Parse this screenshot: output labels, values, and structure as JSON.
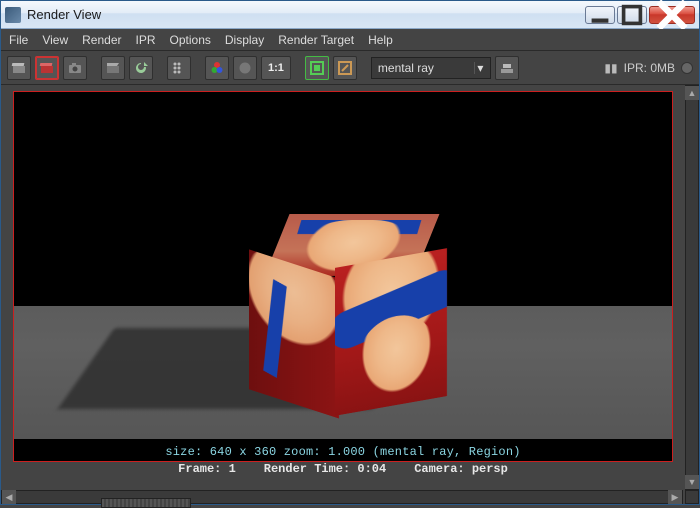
{
  "window": {
    "title": "Render View"
  },
  "menus": {
    "file": "File",
    "view": "View",
    "render": "Render",
    "ipr": "IPR",
    "options": "Options",
    "display": "Display",
    "render_target": "Render Target",
    "help": "Help"
  },
  "toolbar": {
    "ratio_label": "1:1",
    "renderer_selected": "mental ray",
    "ipr_status_label": "IPR: 0MB"
  },
  "render_info": {
    "size_line": "size: 640 x 360  zoom: 1.000      (mental ray, Region)"
  },
  "status": {
    "frame": "Frame: 1",
    "render_time": "Render Time: 0:04",
    "camera": "Camera: persp"
  },
  "colors": {
    "region_border": "#cc1f1f",
    "overlay_text": "#8bd6e3"
  }
}
